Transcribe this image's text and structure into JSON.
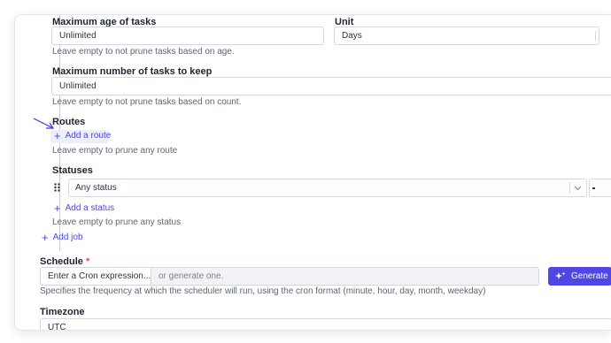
{
  "age": {
    "label": "Maximum age of tasks",
    "value": "Unlimited",
    "hint": "Leave empty to not prune tasks based on age."
  },
  "unit": {
    "label": "Unit",
    "value": "Days"
  },
  "count": {
    "label": "Maximum number of tasks to keep",
    "value": "Unlimited",
    "hint": "Leave empty to not prune tasks based on count."
  },
  "routes": {
    "label": "Routes",
    "add_label": "Add a route",
    "hint": "Leave empty to prune any route"
  },
  "statuses": {
    "label": "Statuses",
    "select_value": "Any status",
    "add_label": "Add a status",
    "hint": "Leave empty to prune any status"
  },
  "add_job_label": "Add job",
  "schedule": {
    "label": "Schedule",
    "required_mark": "*",
    "input_placeholder": "Enter a Cron expression...",
    "generate_placeholder": "or generate one.",
    "generate_button": "Generate",
    "hint": "Specifies the frequency at which the scheduler will run, using the cron format (minute, hour, day, month, weekday)"
  },
  "timezone": {
    "label": "Timezone",
    "value": "UTC"
  },
  "colors": {
    "accent": "#4f46e5",
    "link": "#4c46db",
    "required": "#e5484d",
    "annotation_arrow": "#3b3bd6"
  },
  "icons": [
    "plus-icon",
    "drag-handle-icon",
    "chevron-down-icon",
    "sparkle-icon",
    "annotation-arrow-icon"
  ]
}
